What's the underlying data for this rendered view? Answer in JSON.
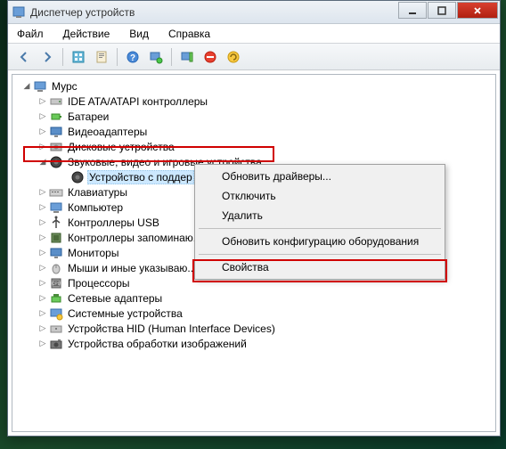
{
  "window": {
    "title": "Диспетчер устройств"
  },
  "menu": {
    "file": "Файл",
    "action": "Действие",
    "view": "Вид",
    "help": "Справка"
  },
  "toolbar_icons": [
    "back",
    "forward",
    "show-all",
    "properties",
    "help",
    "webcam",
    "net",
    "play",
    "stop"
  ],
  "tree": {
    "root": "Мурс",
    "categories": [
      {
        "id": "ide",
        "label": "IDE ATA/ATAPI контроллеры",
        "icon": "drive"
      },
      {
        "id": "bat",
        "label": "Батареи",
        "icon": "battery"
      },
      {
        "id": "video",
        "label": "Видеоадаптеры",
        "icon": "monitor"
      },
      {
        "id": "disk",
        "label": "Дисковые устройства",
        "icon": "disk"
      },
      {
        "id": "sound",
        "label": "Звуковые, видео и игровые устройства",
        "icon": "speaker",
        "expanded": true,
        "children": [
          {
            "id": "snddev",
            "label": "Устройство с поддер",
            "icon": "speaker",
            "selected": true
          }
        ]
      },
      {
        "id": "kbd",
        "label": "Клавиатуры",
        "icon": "keyboard"
      },
      {
        "id": "comp",
        "label": "Компьютер",
        "icon": "computer"
      },
      {
        "id": "usb",
        "label": "Контроллеры USB",
        "icon": "usb"
      },
      {
        "id": "stor",
        "label": "Контроллеры запоминаю...",
        "icon": "chip"
      },
      {
        "id": "mon",
        "label": "Мониторы",
        "icon": "monitor"
      },
      {
        "id": "mouse",
        "label": "Мыши и иные указываю...",
        "icon": "mouse"
      },
      {
        "id": "proc",
        "label": "Процессоры",
        "icon": "cpu"
      },
      {
        "id": "net",
        "label": "Сетевые адаптеры",
        "icon": "net"
      },
      {
        "id": "sys",
        "label": "Системные устройства",
        "icon": "system"
      },
      {
        "id": "hid",
        "label": "Устройства HID (Human Interface Devices)",
        "icon": "hid"
      },
      {
        "id": "img",
        "label": "Устройства обработки изображений",
        "icon": "camera"
      }
    ]
  },
  "context_menu": {
    "update_drivers": "Обновить драйверы...",
    "disable": "Отключить",
    "remove": "Удалить",
    "scan": "Обновить конфигурацию оборудования",
    "properties": "Свойства"
  }
}
